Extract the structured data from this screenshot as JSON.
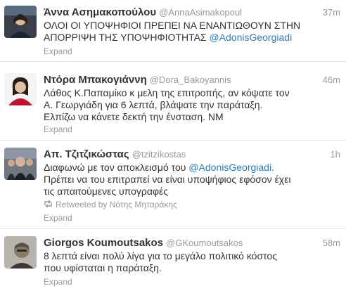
{
  "tweets": [
    {
      "name": "Άννα Ασημακοπούλου",
      "handle": "@AnnaAsimakopoul",
      "time": "37m",
      "lines": [
        {
          "text": "ΟΛΟΙ ΟΙ ΥΠΟΨΗΦΙΟΙ ΠΡΕΠΕΙ ΝΑ ΕΝΑΝΤΙΩΘΟΥΝ ΣΤΗΝ",
          "mention": ""
        },
        {
          "text": "ΑΠΟΡΡΙΨΗ ΤΗΣ ΥΠΟΨΗΦΙΟΤΗΤΑΣ ",
          "mention": "@AdonisGeorgiadi"
        }
      ],
      "expand": "Expand"
    },
    {
      "name": "Ντόρα Μπακογιάννη",
      "handle": "@Dora_Bakoyannis",
      "time": "46m",
      "lines": [
        {
          "text": "Λάθος Κ.Παπαμίκο κ μελη της επιτροπής, αν κόψατε τον",
          "mention": ""
        },
        {
          "text": "Α. Γεωργιάδη για 6 λεπτά, βλάψατε την παράταξη.",
          "mention": ""
        },
        {
          "text": "Ελπίζω να κάνετε δεκτή την ένσταση. ΝΜ",
          "mention": ""
        }
      ],
      "expand": "Expand"
    },
    {
      "name": "Απ. Τζιτζικώστας",
      "handle": "@tzitzikostas",
      "time": "1h",
      "lines": [
        {
          "text": "Διαφωνώ με τον αποκλεισμό του ",
          "mention": "@AdonisGeorgiadi."
        },
        {
          "text": "Πρέπει να του επιτραπεί να είναι υποψήφιος εφόσον έχει",
          "mention": ""
        },
        {
          "text": "τις απαιτούμενες υπογραφές",
          "mention": ""
        }
      ],
      "retweet": "Retweeted by Νότης Μηταράκης",
      "expand": "Expand"
    },
    {
      "name": "Giorgos Koumoutsakos",
      "handle": "@GKoumoutsakos",
      "time": "58m",
      "lines": [
        {
          "text": "8 λεπτά είναι πολύ λίγα για το μεγάλο πολιτικό κόστος",
          "mention": ""
        },
        {
          "text": "που υφίσταται η παράταξη.",
          "mention": ""
        }
      ],
      "expand": "Expand"
    }
  ],
  "colors": {
    "link": "#2b7bb9",
    "meta": "#999999",
    "text": "#333333"
  },
  "icons": {
    "retweet": "retweet-icon"
  }
}
